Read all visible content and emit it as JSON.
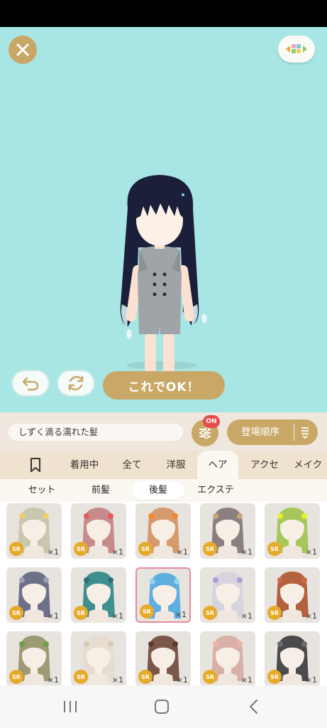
{
  "header": {
    "close_icon": "close-icon",
    "menu_icon": "grid-color-icon"
  },
  "actions": {
    "undo_icon": "undo-arrow-icon",
    "rotate_icon": "rotate-icon",
    "confirm_label": "これでOK！"
  },
  "toolbar": {
    "current_item": "しずく滴る濡れた髪",
    "filter_badge": "ON",
    "sort_label": "登場順序",
    "filter_icon": "sliders-icon",
    "sort_icon": "sort-lines-icon"
  },
  "categories": [
    "着用中",
    "全て",
    "洋服",
    "ヘア",
    "アクセ",
    "メイク"
  ],
  "active_category": "ヘア",
  "subcategories": [
    "セット",
    "前髪",
    "後髪",
    "エクステ"
  ],
  "active_subcategory": "後髪",
  "items": [
    {
      "rarity": "SR",
      "qty": "×1",
      "hair": "#c9c7ad",
      "deco": "#f0cf6a"
    },
    {
      "rarity": "SR",
      "qty": "×1",
      "hair": "#c88b8b",
      "deco": "#e85a5a"
    },
    {
      "rarity": "SR",
      "qty": "×1",
      "hair": "#d69a6c",
      "deco": "#ef8a32"
    },
    {
      "rarity": "SR",
      "qty": "×1",
      "hair": "#8c7f7f",
      "deco": "#c9a77a"
    },
    {
      "rarity": "SR",
      "qty": "×1",
      "hair": "#a7c65b",
      "deco": "#e5f02a"
    },
    {
      "rarity": "SR",
      "qty": "×1",
      "hair": "#6c7088",
      "deco": "#9aa0b8"
    },
    {
      "rarity": "SR",
      "qty": "×1",
      "hair": "#3f8f8e",
      "deco": "#2f6f7a"
    },
    {
      "rarity": "SR",
      "qty": "×1",
      "hair": "#5faee0",
      "deco": "#8fd3f3",
      "selected": true
    },
    {
      "rarity": "SR",
      "qty": "×1",
      "hair": "#d8d4de",
      "deco": "#b49bd8"
    },
    {
      "rarity": "SR",
      "qty": "×1",
      "hair": "#b2623f",
      "deco": "#c96a44"
    },
    {
      "rarity": "SR",
      "qty": "×1",
      "hair": "#9e9a74",
      "deco": "#6aa04a"
    },
    {
      "rarity": "SR",
      "qty": "×1",
      "hair": "#e6ddd0",
      "deco": "#d8cbb6"
    },
    {
      "rarity": "SR",
      "qty": "×1",
      "hair": "#7a5748",
      "deco": "#5d3b2c"
    },
    {
      "rarity": "SR",
      "qty": "×1",
      "hair": "#d9b0a8",
      "deco": "#efb3a3"
    },
    {
      "rarity": "SR",
      "qty": "×1",
      "hair": "#4b4b4e",
      "deco": "#6b6b70"
    }
  ],
  "navbar": {
    "recent_icon": "recent-apps-icon",
    "home_icon": "home-icon",
    "back_icon": "back-icon"
  },
  "colors": {
    "stage_bg": "#a7e6e4",
    "accent_gold": "#c9a867",
    "badge_red": "#e74c4c",
    "rarity_gold": "#e7ab2a"
  }
}
